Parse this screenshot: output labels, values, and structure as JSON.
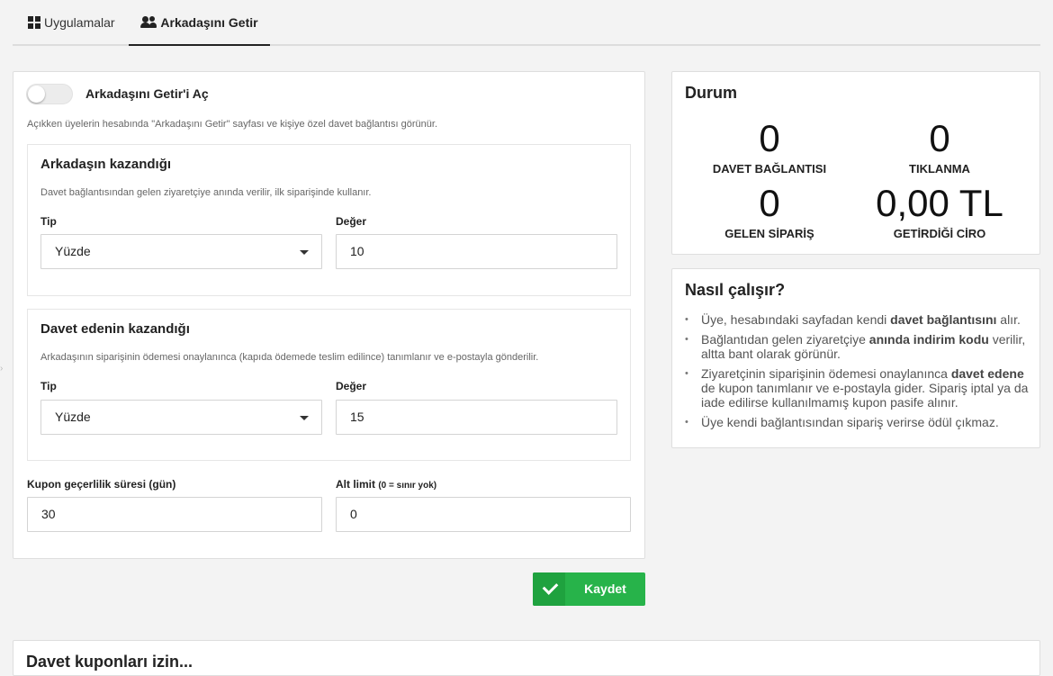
{
  "tabs": [
    {
      "label": "Uygulamalar",
      "icon": "grid-icon",
      "active": false
    },
    {
      "label": "Arkadaşını Getir",
      "icon": "users-icon",
      "active": true
    }
  ],
  "settings": {
    "toggle_label": "Arkadaşını Getir'i Aç",
    "toggle_on": false,
    "toggle_desc": "Açıkken üyelerin hesabında \"Arkadaşını Getir\" sayfası ve kişiye özel davet bağlantısı görünür.",
    "friend": {
      "title": "Arkadaşın kazandığı",
      "desc": "Davet bağlantısından gelen ziyaretçiye anında verilir, ilk siparişinde kullanır.",
      "type_label": "Tip",
      "type_value": "Yüzde",
      "value_label": "Değer",
      "value": "10"
    },
    "inviter": {
      "title": "Davet edenin kazandığı",
      "desc": "Arkadaşının siparişinin ödemesi onaylanınca (kapıda ödemede teslim edilince) tanımlanır ve e-postayla gönderilir.",
      "type_label": "Tip",
      "type_value": "Yüzde",
      "value_label": "Değer",
      "value": "15"
    },
    "validity_label": "Kupon geçerlilik süresi (gün)",
    "validity_value": "30",
    "min_label": "Alt limit",
    "min_note": "(0 = sınır yok)",
    "min_value": "0",
    "save_label": "Kaydet"
  },
  "status": {
    "title": "Durum",
    "stats": [
      {
        "value": "0",
        "caption": "DAVET BAĞLANTISI"
      },
      {
        "value": "0",
        "caption": "TIKLANMA"
      },
      {
        "value": "0",
        "caption": "GELEN SİPARİŞ"
      },
      {
        "value": "0,00 TL",
        "caption": "GETİRDİĞİ CİRO"
      }
    ]
  },
  "how": {
    "title": "Nasıl çalışır?",
    "items": [
      {
        "pre": "Üye, hesabındaki sayfadan kendi ",
        "bold": "davet bağlantısını",
        "post": " alır."
      },
      {
        "pre": "Bağlantıdan gelen ziyaretçiye ",
        "bold": "anında indirim kodu",
        "post": " verilir, altta bant olarak görünür."
      },
      {
        "pre": "Ziyaretçinin siparişinin ödemesi onaylanınca ",
        "bold": "davet edene",
        "post": " de kupon tanımlanır ve e-postayla gider. Sipariş iptal ya da iade edilirse kullanılmamış kupon pasife alınır."
      },
      {
        "pre": "Üye kendi bağlantısından sipariş verirse ödül çıkmaz.",
        "bold": "",
        "post": ""
      }
    ]
  },
  "bottom": {
    "title": "Davet kuponları izin..."
  },
  "colors": {
    "accent": "#27b34a",
    "background": "#f3f3f3"
  }
}
